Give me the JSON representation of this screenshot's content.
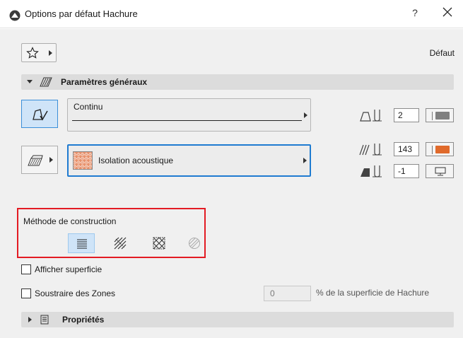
{
  "window": {
    "title": "Options par défaut Hachure",
    "help_label": "?",
    "close_icon": "close-icon"
  },
  "toolbar": {
    "favorites_icon": "star-icon",
    "default_label": "Défaut"
  },
  "general_section": {
    "label": "Paramètres généraux",
    "icon": "hatch-section-icon"
  },
  "outline": {
    "line_type_name": "Continu",
    "pen_number": "2",
    "pen_color": "#808080"
  },
  "fill": {
    "fill_name": "Isolation acoustique",
    "swatch_color": "#e8906a",
    "pen_number": "143",
    "pen_color": "#e06a2b",
    "background_pen_number": "-1",
    "background_icon": "monitor-icon"
  },
  "construction_method": {
    "label": "Méthode de construction",
    "options": [
      {
        "name": "method-lines",
        "selected": true
      },
      {
        "name": "method-hatch-pattern",
        "selected": false
      },
      {
        "name": "method-crosshatch-pattern",
        "selected": false
      },
      {
        "name": "method-custom-pattern",
        "selected": false
      }
    ]
  },
  "show_area": {
    "label": "Afficher superficie",
    "checked": false
  },
  "subtract_zones": {
    "label": "Soustraire des Zones",
    "checked": false,
    "percent_value": "0",
    "percent_suffix": "% de la superficie de Hachure"
  },
  "properties_section": {
    "label": "Propriétés",
    "icon": "document-icon"
  }
}
